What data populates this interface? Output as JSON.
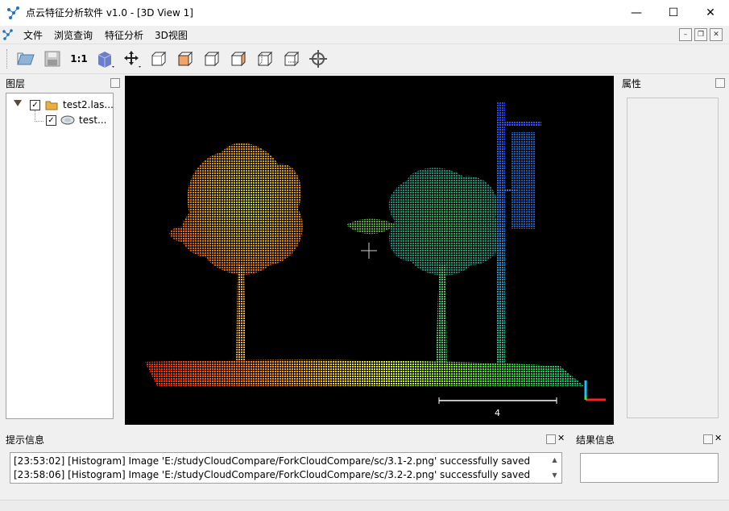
{
  "window": {
    "title": "点云特征分析软件 v1.0 - [3D View 1]",
    "minimize_glyph": "—",
    "maximize_glyph": "☐",
    "close_glyph": "✕"
  },
  "menu": {
    "items": [
      "文件",
      "浏览查询",
      "特征分析",
      "3D视图"
    ]
  },
  "toolbar": {
    "zoom_label": "1:1",
    "icons": [
      "open-folder-icon",
      "save-icon",
      "zoom-1-1-icon",
      "cube-view-icon",
      "translate-icon",
      "view-front-icon",
      "view-top-icon",
      "view-left-icon",
      "view-right-icon",
      "view-back-icon",
      "view-bottom-icon",
      "point-picking-icon"
    ]
  },
  "layers": {
    "title": "图层",
    "items": [
      {
        "label": "test2.las...",
        "checked": "✓"
      },
      {
        "label": "test...",
        "checked": "✓"
      }
    ]
  },
  "properties": {
    "title": "属性"
  },
  "viewer": {
    "scale_label": "4"
  },
  "console": {
    "title": "提示信息",
    "lines": [
      "[23:53:02] [Histogram] Image 'E:/studyCloudCompare/ForkCloudCompare/sc/3.1-2.png' successfully saved",
      "[23:58:06] [Histogram] Image 'E:/studyCloudCompare/ForkCloudCompare/sc/3.2-2.png' successfully saved"
    ]
  },
  "results": {
    "title": "结果信息"
  },
  "colors": {
    "accent": "#1e73be",
    "viewer_bg": "#000000"
  }
}
